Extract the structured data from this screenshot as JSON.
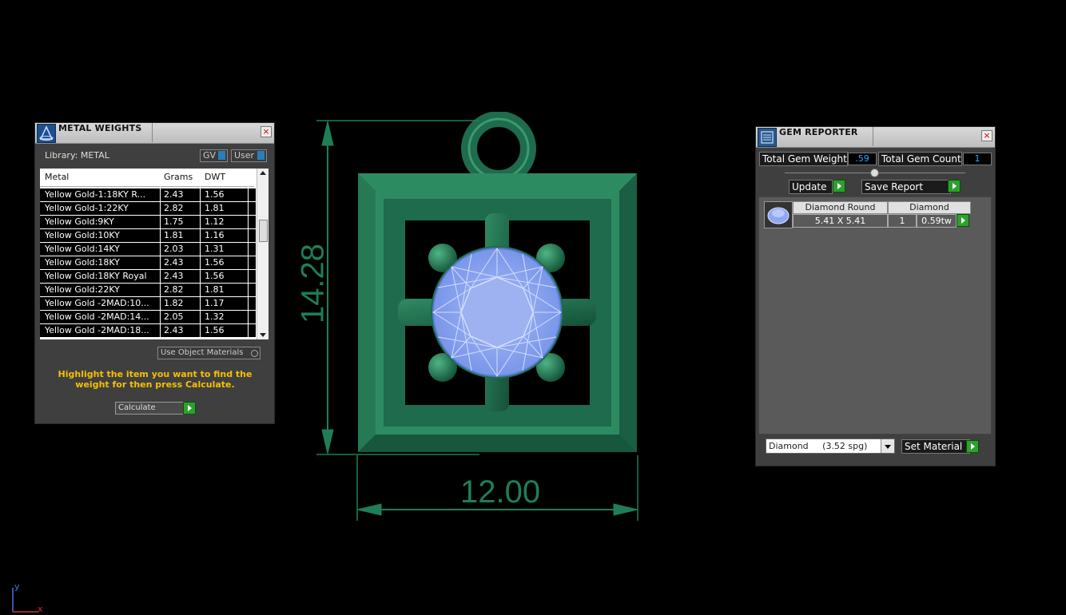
{
  "metal_panel": {
    "title": "METAL WEIGHTS",
    "library_label": "Library: METAL",
    "gv_label": "GV",
    "user_label": "User",
    "columns": [
      "Metal",
      "Grams",
      "DWT"
    ],
    "rows": [
      [
        "Yellow Gold-1:18KY R...",
        "2.43",
        "1.56"
      ],
      [
        "Yellow Gold-1:22KY",
        "2.82",
        "1.81"
      ],
      [
        "Yellow Gold:9KY",
        "1.75",
        "1.12"
      ],
      [
        "Yellow Gold:10KY",
        "1.81",
        "1.16"
      ],
      [
        "Yellow Gold:14KY",
        "2.03",
        "1.31"
      ],
      [
        "Yellow Gold:18KY",
        "2.43",
        "1.56"
      ],
      [
        "Yellow Gold:18KY Royal",
        "2.43",
        "1.56"
      ],
      [
        "Yellow Gold:22KY",
        "2.82",
        "1.81"
      ],
      [
        "Yellow Gold -2MAD:10...",
        "1.82",
        "1.17"
      ],
      [
        "Yellow Gold -2MAD:14...",
        "2.05",
        "1.32"
      ],
      [
        "Yellow Gold -2MAD:18...",
        "2.43",
        "1.56"
      ]
    ],
    "use_object_materials": "Use Object Materials",
    "instruction": "Highlight the item you want to find the weight for then press Calculate.",
    "calculate_label": "Calculate"
  },
  "gem_panel": {
    "title": "GEM REPORTER",
    "total_weight_label": "Total Gem Weight",
    "total_weight_value": ".59",
    "total_count_label": "Total Gem Count",
    "total_count_value": "1",
    "update_label": "Update",
    "save_report_label": "Save Report",
    "gem_header_shape": "Diamond Round",
    "gem_header_type": "Diamond",
    "gem_size": "5.41 X 5.41",
    "gem_count": "1",
    "gem_weight": "0.59tw",
    "material_select": "Diamond     (3.52 spg)",
    "set_material_label": "Set Material"
  },
  "viewport": {
    "height_dim": "14.28",
    "width_dim": "12.00",
    "axis_y": "y",
    "axis_x": "x"
  },
  "colors": {
    "metal_green": "#1f6b4d",
    "dimension_green": "#1e7f56",
    "gem_blue": "#8fa8f2",
    "accent_green_button": "#2ea02e",
    "instruction_yellow": "#f5c000"
  }
}
